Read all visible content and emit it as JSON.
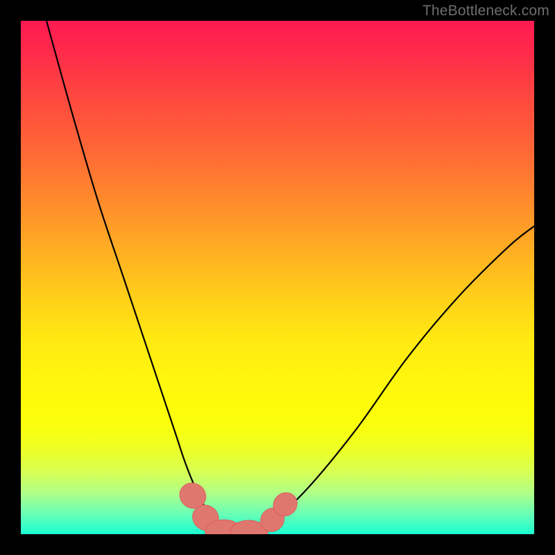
{
  "watermark": "TheBottleneck.com",
  "colors": {
    "frame": "#000000",
    "curve_stroke": "#000000",
    "marker_fill": "#e0776f",
    "marker_stroke": "#d85f58",
    "gradient_top": "#ff1a52",
    "gradient_bottom": "#1affd2"
  },
  "chart_data": {
    "type": "line",
    "title": "",
    "xlabel": "",
    "ylabel": "",
    "xlim": [
      0,
      100
    ],
    "ylim": [
      0,
      100
    ],
    "series": [
      {
        "name": "bottleneck-curve",
        "x": [
          5,
          10,
          15,
          20,
          25,
          30,
          32,
          34,
          36,
          38,
          40,
          42,
          44,
          48,
          55,
          65,
          75,
          85,
          95,
          100
        ],
        "y": [
          100,
          82,
          65,
          50,
          35,
          20,
          14,
          9,
          5,
          2,
          0,
          0,
          0,
          2,
          8,
          20,
          34,
          46,
          56,
          60
        ]
      }
    ],
    "markers": [
      {
        "name": "left-dip-marker-1",
        "x": 33.5,
        "y": 7.5,
        "rx": 2.4,
        "ry": 2.6,
        "rot": -55
      },
      {
        "name": "left-dip-marker-2",
        "x": 36.0,
        "y": 3.2,
        "rx": 2.4,
        "ry": 2.6,
        "rot": -55
      },
      {
        "name": "valley-marker-1",
        "x": 39.5,
        "y": 0.5,
        "rx": 2.3,
        "ry": 3.6,
        "rot": 88
      },
      {
        "name": "valley-marker-2",
        "x": 44.5,
        "y": 0.4,
        "rx": 2.3,
        "ry": 3.6,
        "rot": 92
      },
      {
        "name": "right-dip-marker-1",
        "x": 49.0,
        "y": 2.8,
        "rx": 2.2,
        "ry": 2.4,
        "rot": 45
      },
      {
        "name": "right-dip-marker-2",
        "x": 51.5,
        "y": 5.8,
        "rx": 2.2,
        "ry": 2.4,
        "rot": 50
      }
    ]
  }
}
